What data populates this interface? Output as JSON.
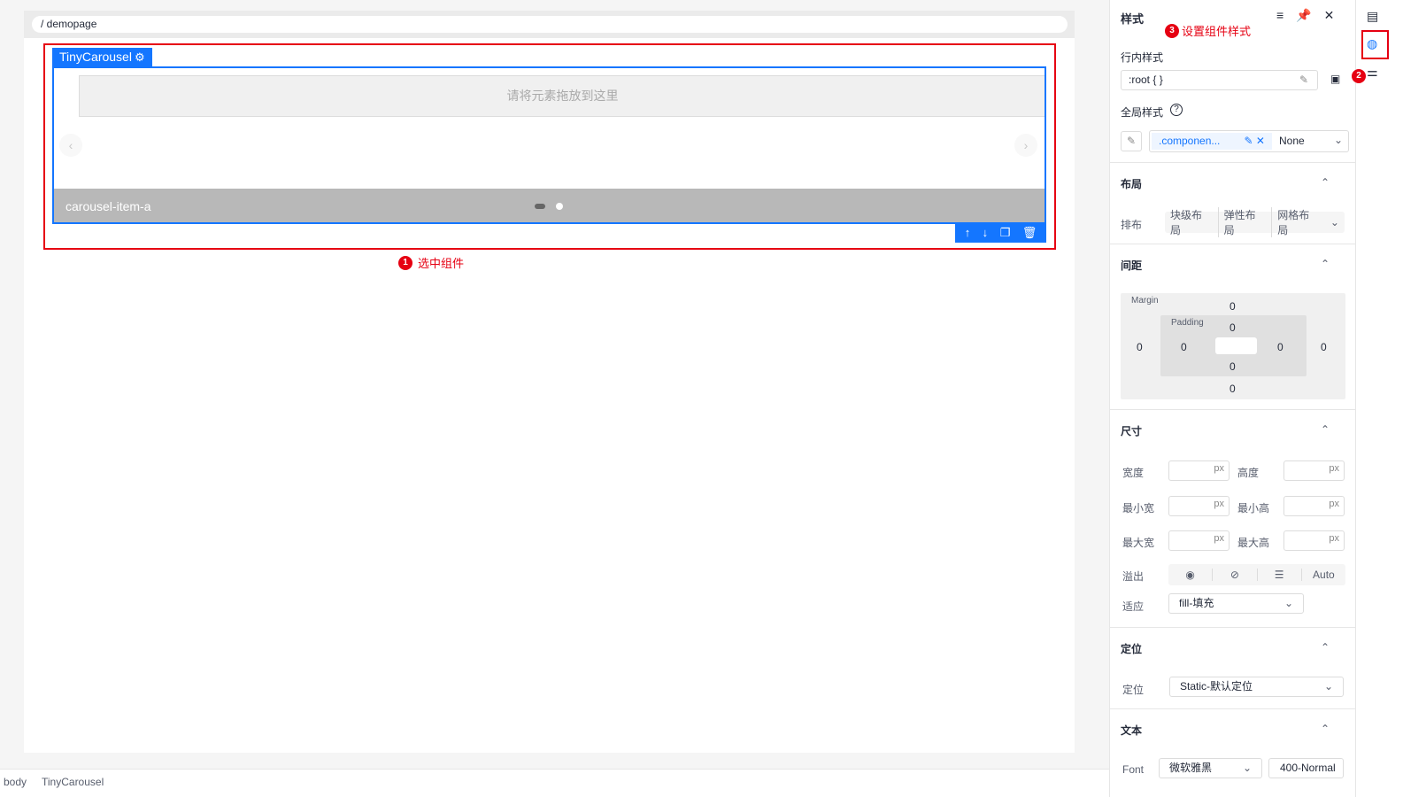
{
  "canvas": {
    "breadcrumb": "/ demopage",
    "component_badge": "TinyCarousel",
    "drop_zone": "请将元素拖放到这里",
    "carousel_item_title": "carousel-item-a",
    "annotation_select": "选中组件",
    "annotation_num_1": "1"
  },
  "statusbar": {
    "items": [
      "body",
      "TinyCarousel"
    ]
  },
  "panel": {
    "title": "样式",
    "annotation_style": "设置组件样式",
    "annotation_num_3": "3",
    "inline_style_label": "行内样式",
    "inline_style_value": ":root { }",
    "global_style_label": "全局样式",
    "class_tag": ".componen...",
    "class_select": "None",
    "layout": {
      "title": "布局",
      "arrange_label": "排布",
      "options": [
        "块级布局",
        "弹性布局",
        "网格布局"
      ]
    },
    "spacing": {
      "title": "间距",
      "margin_label": "Margin",
      "padding_label": "Padding",
      "margin": {
        "top": "0",
        "right": "0",
        "bottom": "0",
        "left": "0"
      },
      "padding": {
        "top": "0",
        "right": "0",
        "bottom": "0",
        "left": "0"
      }
    },
    "size": {
      "title": "尺寸",
      "width_label": "宽度",
      "height_label": "高度",
      "min_width_label": "最小宽",
      "min_height_label": "最小高",
      "max_width_label": "最大宽",
      "max_height_label": "最大高",
      "unit": "px",
      "overflow_label": "溢出",
      "overflow_auto": "Auto",
      "fit_label": "适应",
      "fit_value": "fill-填充"
    },
    "position": {
      "title": "定位",
      "label": "定位",
      "value": "Static-默认定位"
    },
    "text": {
      "title": "文本",
      "font_label": "Font",
      "font_family": "微软雅黑",
      "font_weight": "400-Normal"
    }
  },
  "rail": {
    "annotation_num_2": "2"
  },
  "colors": {
    "accent": "#1476ff",
    "annotation": "#e60012"
  }
}
